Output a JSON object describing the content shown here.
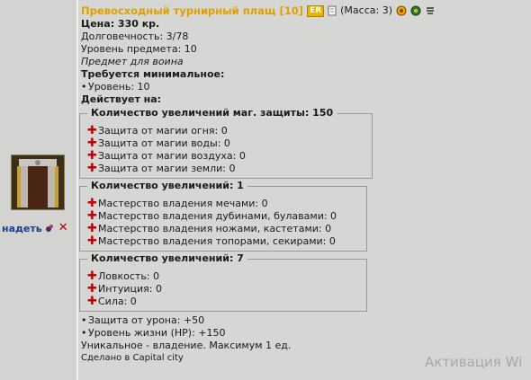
{
  "item": {
    "title": "Превосходный турнирный плащ [10]",
    "badge": "ER",
    "mass": "(Масса: 3)",
    "price": "Цена: 330 кр.",
    "durability": "Долговечность: 3/78",
    "item_level": "Уровень предмета: 10",
    "class_note": "Предмет для воина",
    "requires_header": "Требуется минимальное:",
    "requires": [
      "Уровень: 10"
    ],
    "effects_header": "Действует на:",
    "groups": [
      {
        "title": "Количество увеличений маг. защиты: 150",
        "items": [
          "Защита от магии огня: 0",
          "Защита от магии воды: 0",
          "Защита от магии воздуха: 0",
          "Защита от магии земли: 0"
        ]
      },
      {
        "title": "Количество увеличений: 1",
        "items": [
          "Мастерство владения мечами: 0",
          "Мастерство владения дубинами, булавами: 0",
          "Мастерство владения ножами, кастетами: 0",
          "Мастерство владения топорами, секирами: 0"
        ]
      },
      {
        "title": "Количество увеличений: 7",
        "items": [
          "Ловкость: 0",
          "Интуиция: 0",
          "Сила: 0"
        ]
      }
    ],
    "bonuses": [
      "Защита от урона: +50",
      "Уровень жизни (HP): +150"
    ],
    "unique": "Уникальное - владение. Максимум 1 ед.",
    "made_in": "Сделано в Capital city"
  },
  "actions": {
    "equip_label": "надеть"
  },
  "watermark": "Активация Wi",
  "colors": {
    "title": "#e0a000",
    "plus": "#c40000",
    "link": "#1a3c8a"
  }
}
